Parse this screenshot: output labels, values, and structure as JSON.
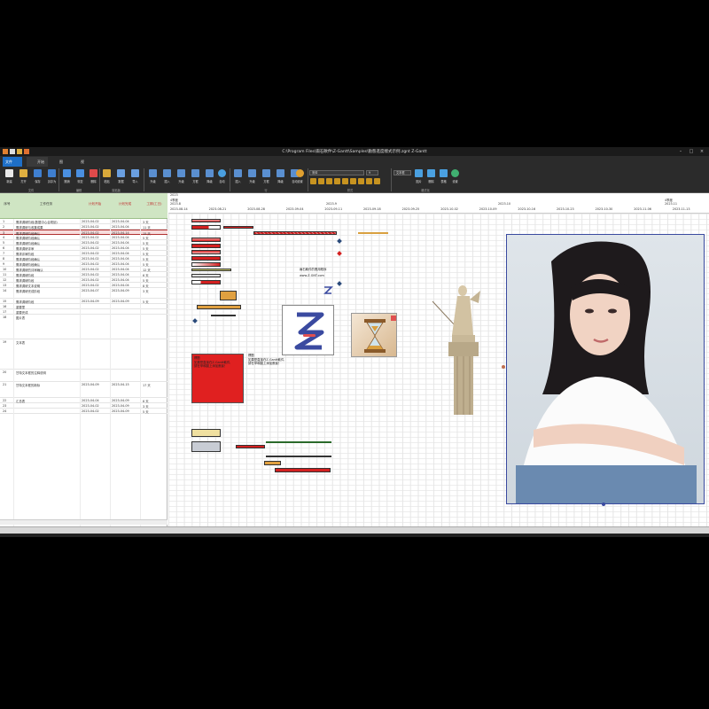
{
  "window": {
    "title": "C:\\Program Files\\兩石軟件\\Z-Gantt\\Samples\\動態進度樣式示例.zgnt   Z-Gantt"
  },
  "tabs": [
    "文件",
    "开始",
    "图表",
    "视图"
  ],
  "ribbon": {
    "buttons": [
      "新建",
      "打开",
      "保存",
      "另存为",
      "撤销",
      "恢复",
      "删除",
      "粘贴",
      "数据",
      "导入",
      "升级",
      "插入",
      "升级",
      "方框",
      "降级",
      "自动",
      "插入",
      "升级",
      "方框",
      "降级",
      "自动",
      "设置",
      "文本框",
      "图片",
      "形状",
      "标注",
      "表格",
      "删除",
      "设置"
    ],
    "groups": [
      "文件",
      "编辑",
      "剪贴板",
      "行",
      "图形",
      "样式",
      "格式化"
    ],
    "font_name": "宋体",
    "font_size": "9"
  },
  "table": {
    "headers": {
      "id": "序号",
      "task": "工作任务",
      "start": "计划开始",
      "end": "计划完成",
      "duration": "工期(工日)"
    },
    "rows": [
      {
        "id": "1",
        "task": "需求调研阶段(数据中心合规划)",
        "start": "2023-04-02",
        "end": "2023-04-04",
        "dur": "3 天"
      },
      {
        "id": "2",
        "task": "需求调研与收集成果",
        "start": "2023-04-02",
        "end": "2023-04-04",
        "dur": "11 天"
      },
      {
        "id": "3",
        "task": "需求调研阶段确认",
        "start": "2023-04-02",
        "end": "2023-04-14",
        "dur": "15 天"
      },
      {
        "id": "4",
        "task": "需求调研阶段确认",
        "start": "2023-04-02",
        "end": "2023-04-04",
        "dur": "5 天"
      },
      {
        "id": "5",
        "task": "需求调研阶段确认",
        "start": "2023-04-02",
        "end": "2023-04-04",
        "dur": "5 天"
      },
      {
        "id": "6",
        "task": "需求调研评审",
        "start": "2023-04-02",
        "end": "2023-04-04",
        "dur": "5 天"
      },
      {
        "id": "7",
        "task": "需求评审阶段",
        "start": "2023-04-02",
        "end": "2023-04-04",
        "dur": "5 天"
      },
      {
        "id": "8",
        "task": "需求调研阶段确认",
        "start": "2023-04-02",
        "end": "2023-04-04",
        "dur": "5 天"
      },
      {
        "id": "9",
        "task": "需求调研阶段确认",
        "start": "2023-04-02",
        "end": "2023-04-04",
        "dur": "5 天"
      },
      {
        "id": "10",
        "task": "需求调研的评审确认",
        "start": "2023-04-02",
        "end": "2023-04-04",
        "dur": "12 天"
      },
      {
        "id": "11",
        "task": "需求调研阶段",
        "start": "2023-04-02",
        "end": "2023-04-04",
        "dur": "6 天"
      },
      {
        "id": "12",
        "task": "需求调研阶段",
        "start": "2023-04-02",
        "end": "2023-04-04",
        "dur": "5 天"
      },
      {
        "id": "13",
        "task": "需求调研文本说明",
        "start": "2023-04-02",
        "end": "2023-04-04",
        "dur": "8 天"
      },
      {
        "id": "14",
        "task": "需求调研完成阶段",
        "start": "2023-04-07",
        "end": "2023-04-09",
        "dur": "3 天"
      },
      {
        "id": "15",
        "task": "需求调研阶段",
        "start": "2023-04-09",
        "end": "2023-04-09",
        "dur": "5 天"
      },
      {
        "id": "16",
        "task": "重要里",
        "start": "",
        "end": "",
        "dur": ""
      },
      {
        "id": "17",
        "task": "重要完成",
        "start": "",
        "end": "",
        "dur": ""
      },
      {
        "id": "18",
        "task": "图片表",
        "start": "",
        "end": "",
        "dur": ""
      },
      {
        "id": "19",
        "task": "文本表",
        "start": "",
        "end": "",
        "dur": ""
      },
      {
        "id": "20",
        "task": "甘特文本框的注释说明",
        "start": "",
        "end": "",
        "dur": ""
      },
      {
        "id": "21",
        "task": "甘特文本框的新标",
        "start": "2023-04-09",
        "end": "2023-04-15",
        "dur": "17 天"
      },
      {
        "id": "22",
        "task": "汇总表",
        "start": "2023-04-04",
        "end": "2023-04-09",
        "dur": "6 天"
      },
      {
        "id": "23",
        "task": "",
        "start": "2023-04-02",
        "end": "2023-04-09",
        "dur": "3 天"
      },
      {
        "id": "24",
        "task": "",
        "start": "2023-04-02",
        "end": "2023-04-09",
        "dur": "5 天"
      }
    ]
  },
  "gantt": {
    "header": {
      "year_left": "2023",
      "quarter_left": "4季度",
      "month_left": "2023.8",
      "month_mid": "2023.9",
      "month_right": "2023.10",
      "quarter_right": "4季度",
      "month_far": "2023.11",
      "dates": [
        "2023-08-14",
        "2023-08-21",
        "2023-08-28",
        "2023-09-04",
        "2023-09-11",
        "2023-09-18",
        "2023-09-25",
        "2023-10-02",
        "2023-10-09",
        "2023-10-16",
        "2023-10-23",
        "2023-10-30",
        "2023-11-06",
        "2023-11-13",
        "2023-11-20"
      ]
    },
    "notes": {
      "logo_caption": "兩石軟件的應用程序",
      "logo_url": "www.Z-GNT.com",
      "note1_title": "標題",
      "note1_body": "如果是直接在Z-Gantt軟件,\n請在甲和圖上添加數據！",
      "note2_title": "標題",
      "note2_body": "如果是直接在Z-Gantt軟件,\n請在甲和圖上添加數據！"
    },
    "images": [
      "logo-hourglass",
      "hourglass-photo",
      "statue-photo",
      "portrait-photo"
    ]
  },
  "colors": {
    "accent": "#1e6fc7",
    "bar_red": "#d42020",
    "bar_orange": "#e0a040",
    "table_header": "#cfe5c3"
  }
}
